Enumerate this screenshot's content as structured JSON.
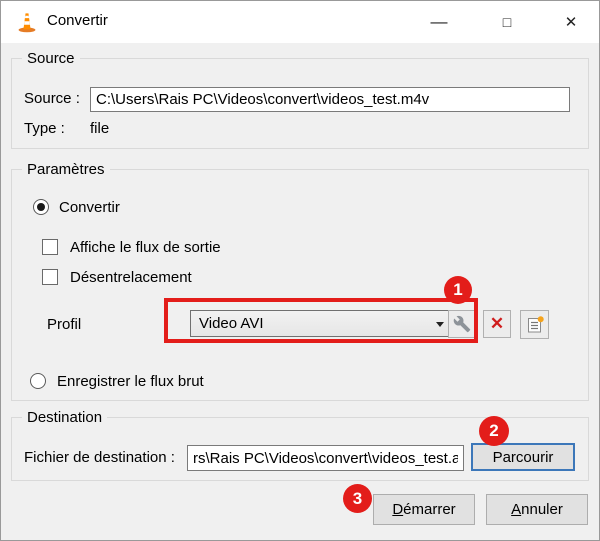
{
  "window": {
    "title": "Convertir"
  },
  "icons": {
    "minimize_glyph": "—",
    "maximize_glyph": "□",
    "close_glyph": "✕",
    "delete_glyph": "✕"
  },
  "source_group": {
    "title": "Source",
    "source_label": "Source :",
    "source_value": "C:\\Users\\Rais PC\\Videos\\convert\\videos_test.m4v",
    "type_label": "Type :",
    "type_value": "file"
  },
  "params_group": {
    "title": "Paramètres",
    "convert_radio_label": "Convertir",
    "display_output_label": "Affiche le flux de sortie",
    "deinterlace_label": "Désentrelacement",
    "profile_label": "Profil",
    "profile_value": "Video AVI",
    "raw_stream_radio_label": "Enregistrer le flux brut"
  },
  "destination_group": {
    "title": "Destination",
    "file_label": "Fichier de destination :",
    "file_value": "rs\\Rais PC\\Videos\\convert\\videos_test.avi",
    "browse_label": "Parcourir"
  },
  "footer": {
    "start_mnemonic": "D",
    "start_rest": "émarrer",
    "cancel_mnemonic": "A",
    "cancel_rest": "nnuler"
  },
  "annotations": {
    "step1": "1",
    "step2": "2",
    "step3": "3",
    "highlight_color": "#e31d1a"
  }
}
